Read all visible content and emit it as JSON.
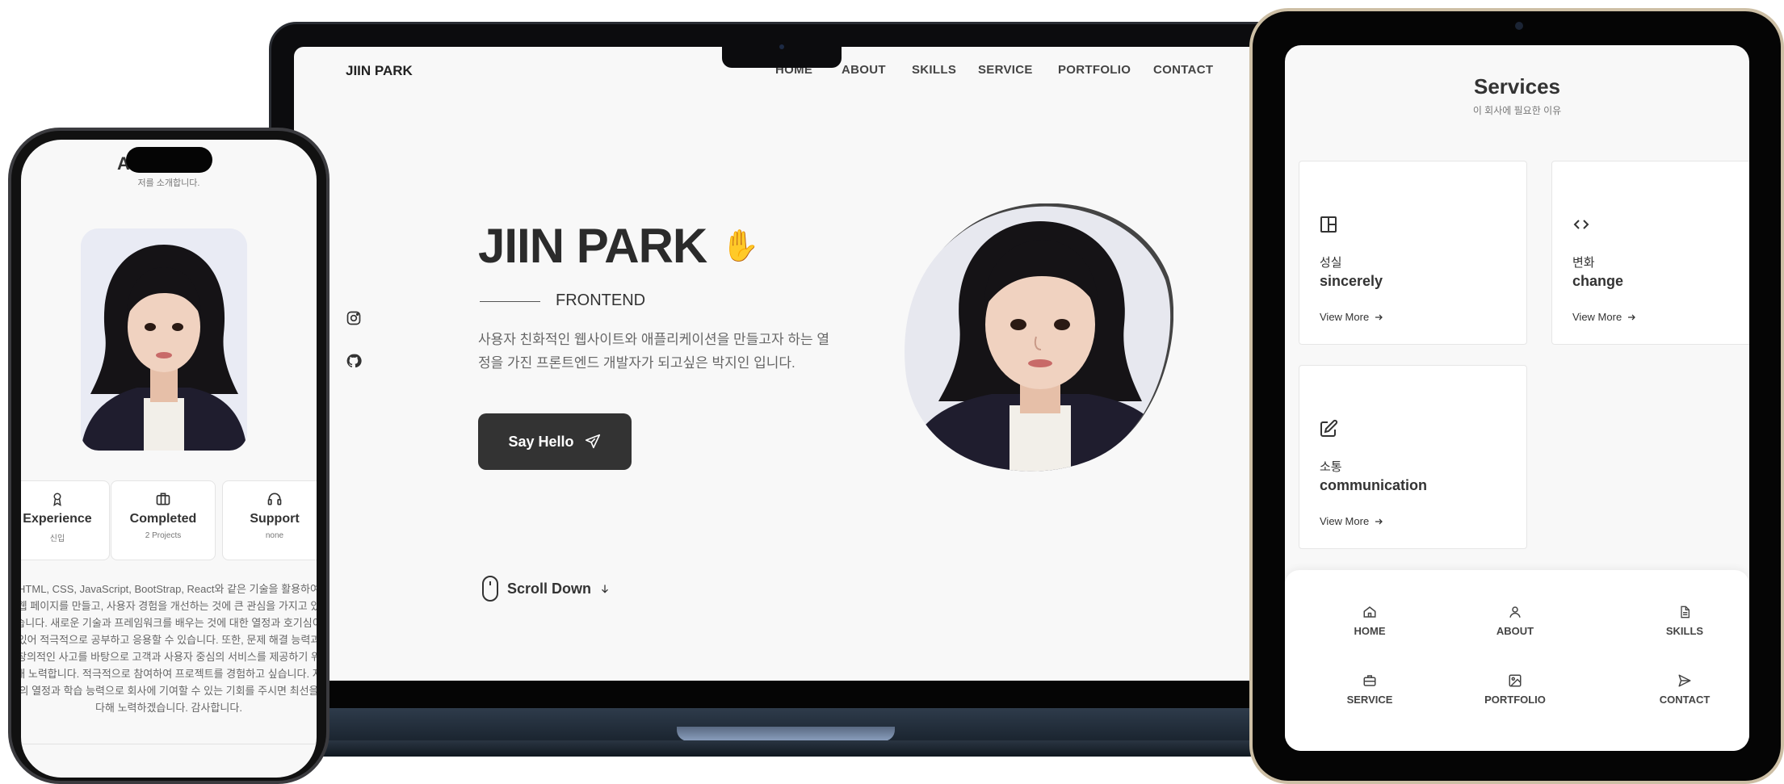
{
  "laptop": {
    "logo": "JIIN PARK",
    "nav": [
      "HOME",
      "ABOUT",
      "SKILLS",
      "SERVICE",
      "PORTFOLIO",
      "CONTACT"
    ],
    "name": "JIIN PARK",
    "hand_emoji": "✋",
    "role": "FRONTEND",
    "description": "사용자 친화적인 웹사이트와 애플리케이션을 만들고자 하는 열정을 가진 프론트엔드 개발자가 되고싶은 박지인 입니다.",
    "button_label": "Say Hello",
    "scroll_label": "Scroll Down",
    "social_icons": [
      "instagram-icon",
      "github-icon"
    ]
  },
  "phone": {
    "title": "About Me",
    "subtitle": "저를 소개합니다.",
    "cards": [
      {
        "title": "Experience",
        "sub": "신입",
        "icon": "award-icon"
      },
      {
        "title": "Completed",
        "sub": "2 Projects",
        "icon": "briefcase-icon"
      },
      {
        "title": "Support",
        "sub": "none",
        "icon": "headset-icon"
      }
    ],
    "description": "HTML, CSS, JavaScript, BootStrap, React와 같은 기술을 활용하여 웹 페이지를 만들고, 사용자 경험을 개선하는 것에 큰 관심을 가지고 있습니다. 새로운 기술과 프레임워크를 배우는 것에 대한 열정과 호기심이 있어 적극적으로 공부하고 응용할 수 있습니다. 또한, 문제 해결 능력과 창의적인 사고를 바탕으로 고객과 사용자 중심의 서비스를 제공하기 위해 노력합니다. 적극적으로 참여하여 프로젝트를 경험하고 싶습니다. 저의 열정과 학습 능력으로 회사에 기여할 수 있는 기회를 주시면 최선을 다해 노력하겠습니다. 감사합니다."
  },
  "tablet": {
    "title": "Services",
    "subtitle": "이 회사에 필요한 이유",
    "services": [
      {
        "kr": "성실",
        "en": "sincerely",
        "link": "View More",
        "icon": "layout-icon"
      },
      {
        "kr": "변화",
        "en": "change",
        "link": "View More",
        "icon": "code-icon"
      },
      {
        "kr": "소통",
        "en": "communication",
        "link": "View More",
        "icon": "edit-icon"
      }
    ],
    "nav": [
      {
        "label": "HOME",
        "icon": "home-icon"
      },
      {
        "label": "ABOUT",
        "icon": "user-icon"
      },
      {
        "label": "SKILLS",
        "icon": "file-icon"
      },
      {
        "label": "SERVICE",
        "icon": "briefcase-icon"
      },
      {
        "label": "PORTFOLIO",
        "icon": "image-icon"
      },
      {
        "label": "CONTACT",
        "icon": "send-icon"
      }
    ]
  }
}
